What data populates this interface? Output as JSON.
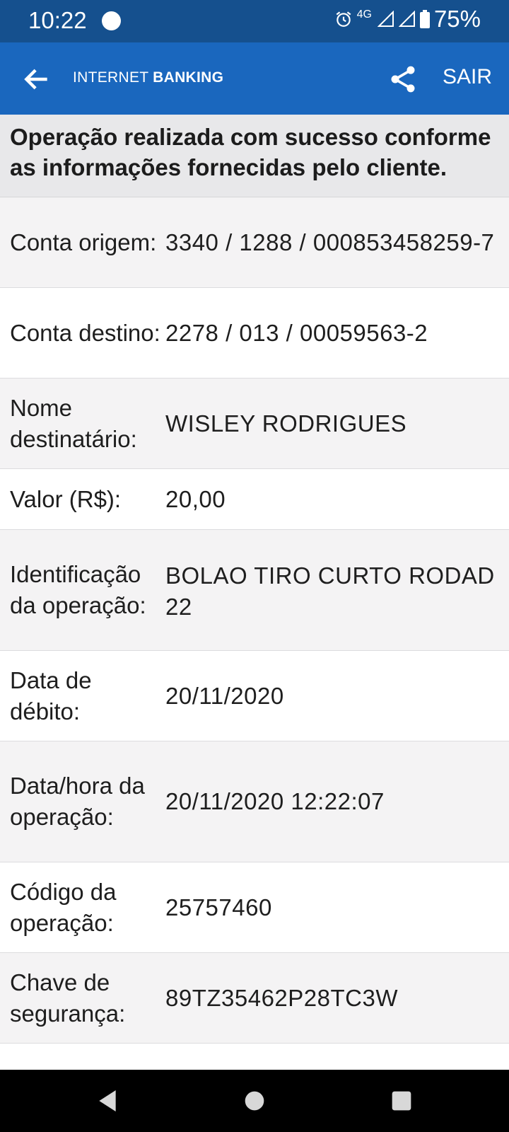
{
  "status_bar": {
    "time": "10:22",
    "network": "4G",
    "battery": "75%"
  },
  "app_bar": {
    "brand_light": "INTERNET ",
    "brand_bold": "BANKING",
    "exit_label": "SAIR"
  },
  "receipt": {
    "message": "Operação realizada com sucesso conforme as informações fornecidas pelo cliente.",
    "rows": [
      {
        "label": "Conta origem:",
        "value": "3340 / 1288 / 000853458259-7"
      },
      {
        "label": "Conta destino:",
        "value": "2278 / 013 / 00059563-2"
      },
      {
        "label": "Nome destinatário:",
        "value": "WISLEY RODRIGUES"
      },
      {
        "label": "Valor (R$):",
        "value": "20,00"
      },
      {
        "label": "Identificação da operação:",
        "value": "BOLAO TIRO CURTO RODAD 22"
      },
      {
        "label": "Data de débito:",
        "value": "20/11/2020"
      },
      {
        "label": "Data/hora da operação:",
        "value": "20/11/2020 12:22:07"
      },
      {
        "label": "Código da operação:",
        "value": "25757460"
      },
      {
        "label": "Chave de segurança:",
        "value": "89TZ35462P28TC3W"
      }
    ]
  },
  "colors": {
    "status_bar": "#15508e",
    "app_bar": "#1a67be"
  }
}
